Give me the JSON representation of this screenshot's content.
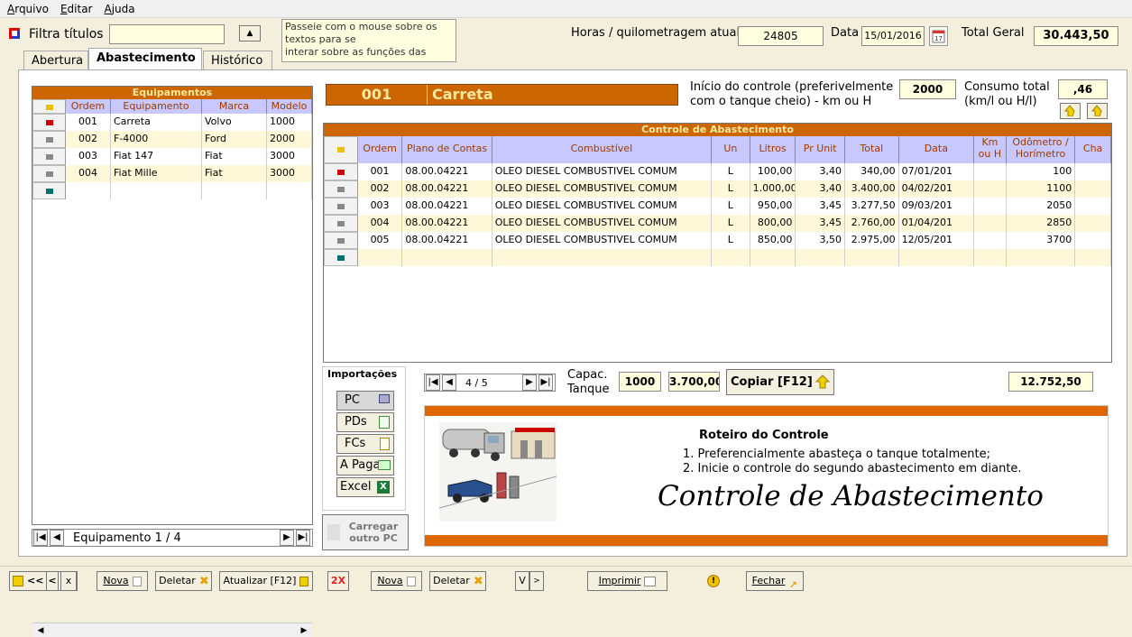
{
  "menu": [
    "Arquivo",
    "Editar",
    "Ajuda"
  ],
  "filter": {
    "label": "Filtra títulos",
    "value": ""
  },
  "tip": {
    "line1": "Passeie com o mouse sobre os",
    "line2": "textos para se",
    "line3": "interar sobre as funções das"
  },
  "header": {
    "horas_label": "Horas / quilometragem atual",
    "horas_value": "24805",
    "data_label": "Data",
    "data_value": "15/01/2016",
    "total_label": "Total Geral",
    "total_value": "30.443,50"
  },
  "tabs": [
    "Abertura",
    "Abastecimento",
    "Histórico"
  ],
  "equip": {
    "title": "Equipamentos",
    "headers": [
      "Ordem",
      "Equipamento",
      "Marca",
      "Modelo"
    ],
    "rows": [
      [
        "001",
        "Carreta",
        "Volvo",
        "1000"
      ],
      [
        "002",
        "F-4000",
        "Ford",
        "2000"
      ],
      [
        "003",
        "Fiat 147",
        "Fiat",
        "3000"
      ],
      [
        "004",
        "Fiat Mille",
        "Fiat",
        "3000"
      ]
    ],
    "nav_label": "Equipamento 1 / 4"
  },
  "selected": {
    "code": "001",
    "name": "Carreta"
  },
  "inicio": {
    "line1": "Início do controle (preferivelmente",
    "line2": "com o tanque cheio) - km ou H",
    "value": "2000"
  },
  "consumo": {
    "line1": "Consumo total",
    "line2": "(km/l ou H/l)",
    "value": ",46"
  },
  "abast": {
    "title": "Controle de Abastecimento",
    "headers": [
      "Ordem",
      "Plano de Contas",
      "Combustível",
      "Un",
      "Litros",
      "Pr Unit",
      "Total",
      "Data",
      "Km ou H",
      "Odômetro / Horímetro",
      "Cha"
    ],
    "rows": [
      [
        "001",
        "08.00.04221",
        "OLEO DIESEL COMBUSTIVEL COMUM",
        "L",
        "100,00",
        "3,40",
        "340,00",
        "07/01/201",
        "",
        "100"
      ],
      [
        "002",
        "08.00.04221",
        "OLEO DIESEL COMBUSTIVEL COMUM",
        "L",
        "1.000,00",
        "3,40",
        "3.400,00",
        "04/02/201",
        "",
        "1100"
      ],
      [
        "003",
        "08.00.04221",
        "OLEO DIESEL COMBUSTIVEL COMUM",
        "L",
        "950,00",
        "3,45",
        "3.277,50",
        "09/03/201",
        "",
        "2050"
      ],
      [
        "004",
        "08.00.04221",
        "OLEO DIESEL COMBUSTIVEL COMUM",
        "L",
        "800,00",
        "3,45",
        "2.760,00",
        "01/04/201",
        "",
        "2850"
      ],
      [
        "005",
        "08.00.04221",
        "OLEO DIESEL COMBUSTIVEL COMUM",
        "L",
        "850,00",
        "3,50",
        "2.975,00",
        "12/05/201",
        "",
        "3700"
      ]
    ],
    "nav_label": "4 / 5"
  },
  "importacoes": {
    "title": "Importações",
    "buttons": [
      "PC",
      "PDs",
      "FCs",
      "A Pagar",
      "Excel"
    ]
  },
  "carregar": "Carregar outro PC",
  "capac": {
    "label1": "Capac.",
    "label2": "Tanque",
    "value1": "1000",
    "value2": "3.700,00"
  },
  "copiar": "Copiar [F12]",
  "total_abast": "12.752,50",
  "roteiro": {
    "title": "Roteiro do Controle",
    "item1": "1. Preferencialmente abasteça o tanque totalmente;",
    "item2": "2. Inicie o controle do segundo abastecimento em diante.",
    "big": "Controle de Abastecimento"
  },
  "bottom": {
    "nav": [
      "<<",
      "<",
      "x"
    ],
    "nova1": "Nova",
    "deletar1": "Deletar",
    "atualizar": "Atualizar [F12]",
    "twox": "2X",
    "nova2": "Nova",
    "deletar2": "Deletar",
    "v": "V",
    "gt": ">",
    "imprimir": "Imprimir",
    "fechar": "Fechar"
  },
  "colors": {
    "orange": "#cc6600",
    "header_blue": "#c8c8ff",
    "field_yellow": "#ffffe0",
    "row_alt": "#fff8d8"
  }
}
